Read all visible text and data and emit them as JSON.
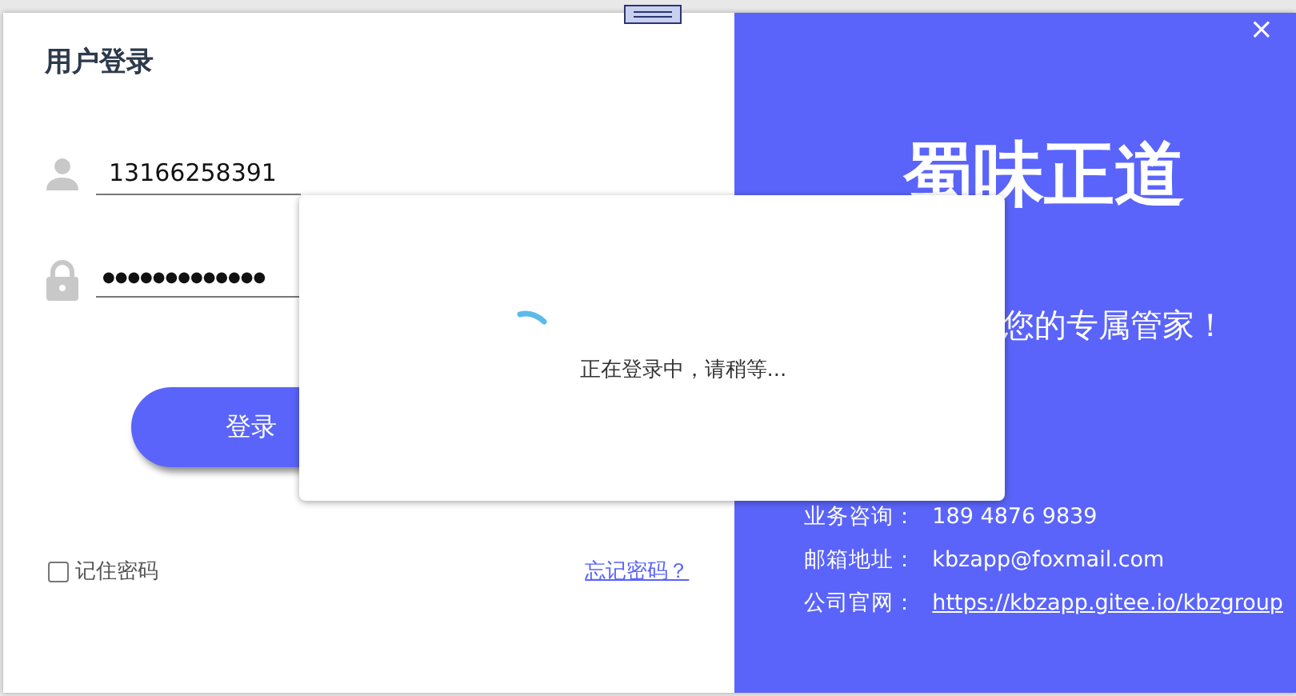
{
  "login_panel": {
    "title": "用户登录",
    "username": {
      "value": "13166258391"
    },
    "password": {
      "mask": "●●●●●●●●●●●●●"
    },
    "login_button": "登录",
    "remember": {
      "label": "记住密码",
      "checked": false
    },
    "forgot_link": "忘记密码？"
  },
  "brand_panel": {
    "close": "×",
    "title": "蜀味正道",
    "subtitle": "您的专属管家！",
    "contacts": [
      {
        "label": "业务咨询：",
        "value": "189 4876 9839",
        "kind": "text"
      },
      {
        "label": "邮箱地址：",
        "value": "kbzapp@foxmail.com",
        "kind": "text"
      },
      {
        "label": "公司官网：",
        "value": "https://kbzapp.gitee.io/kbzgroup",
        "kind": "link"
      }
    ]
  },
  "loading_dialog": {
    "message": "正在登录中，请稍等..."
  }
}
